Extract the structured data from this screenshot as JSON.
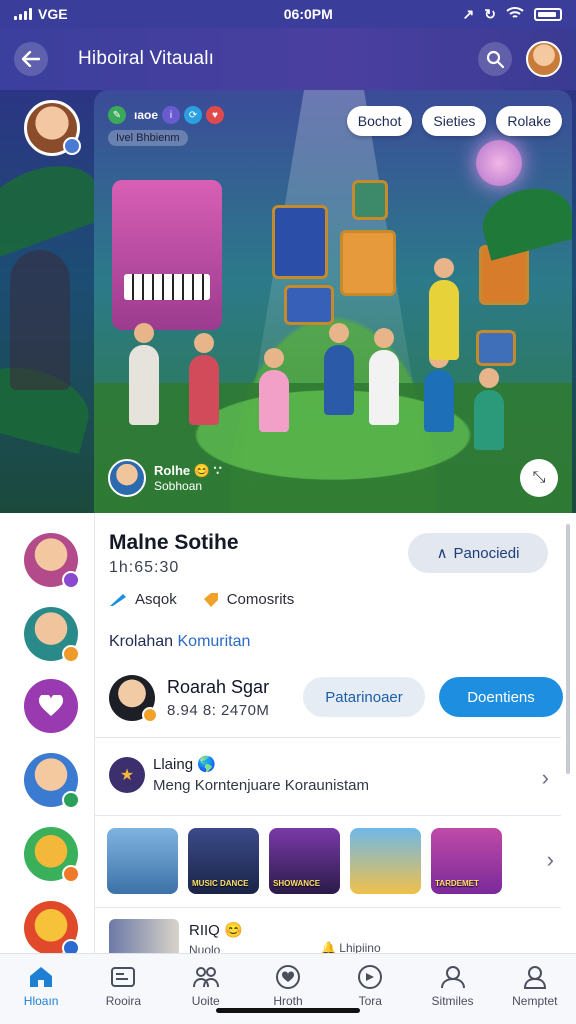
{
  "status_bar": {
    "carrier": "VGE",
    "time": "06:0PM"
  },
  "header": {
    "title": "Hiboiral Vitaualı"
  },
  "hero": {
    "badge_text": "ıaoe",
    "sub_label": "Ivel Bhbienm",
    "pills": [
      "Bochot",
      "Sieties",
      "Rolake"
    ],
    "user_name": "Rolhe 😊 ∵",
    "user_sub": "Sobhoan"
  },
  "community": {
    "title": "Malne Sotihe",
    "time": "1h:65:30",
    "connected_label": "Panociedi",
    "actions": [
      {
        "label": "Asqok"
      },
      {
        "label": "Comosrits"
      }
    ],
    "section_prefix": "Krolahan",
    "section_highlight": "Komuritan",
    "member": {
      "name": "Roarah Sgar",
      "sub": "8.94 8: 2470M",
      "secondary_button": "Patarinoaer",
      "primary_button": "Doentiens"
    },
    "link": {
      "title": "Llaing 🌎",
      "subtitle": "Meng Korntenjuare Koraunistam"
    },
    "thumbnails": [
      {
        "caption": ""
      },
      {
        "caption": "MUSIC DANCE"
      },
      {
        "caption": "SHOWANCE"
      },
      {
        "caption": ""
      },
      {
        "caption": "TARDEMET"
      }
    ],
    "bottom_item": {
      "title": "RIIQ 😊",
      "sub": "Nuolo",
      "sub2": "🔔 Lhipiino"
    }
  },
  "tabs": [
    {
      "label": "Hloaın",
      "icon": "home-icon",
      "active": true
    },
    {
      "label": "Rooira",
      "icon": "gallery-icon",
      "active": false
    },
    {
      "label": "Uoite",
      "icon": "people-icon",
      "active": false
    },
    {
      "label": "Hroth",
      "icon": "heart-icon",
      "active": false
    },
    {
      "label": "Tora",
      "icon": "compass-icon",
      "active": false
    },
    {
      "label": "Sitmiles",
      "icon": "profile-icon",
      "active": false
    },
    {
      "label": "Nemptet",
      "icon": "person-icon",
      "active": false
    }
  ],
  "colors": {
    "accent": "#1e8fe0",
    "header": "#3b3f9d"
  }
}
